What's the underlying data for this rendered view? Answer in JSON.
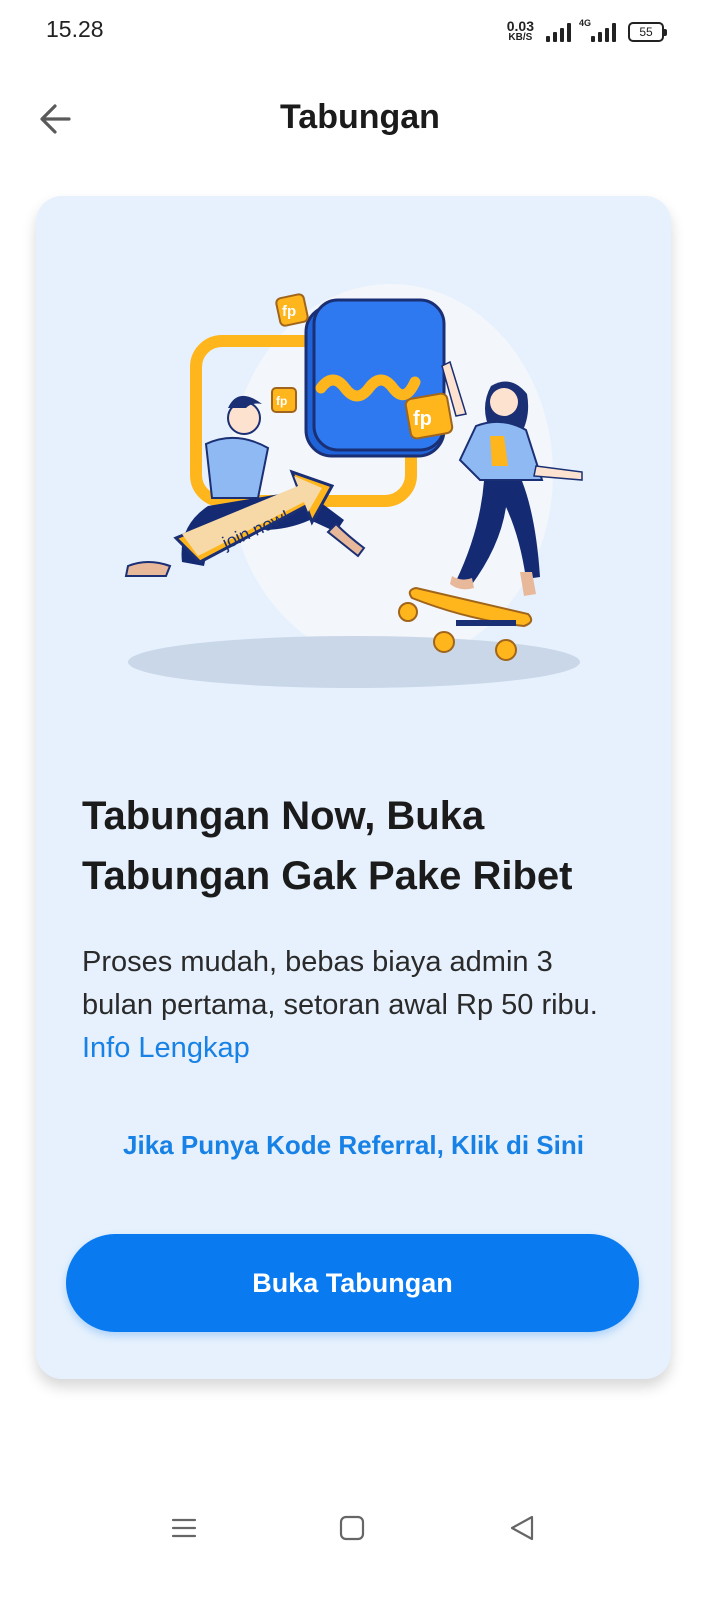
{
  "status_bar": {
    "time": "15.28",
    "net_speed_value": "0.03",
    "net_speed_unit": "KB/S",
    "network_type": "4G",
    "battery": "55"
  },
  "header": {
    "title": "Tabungan",
    "back_icon": "arrow-left-icon"
  },
  "card": {
    "illustration": {
      "badge_text": "fp",
      "arrow_text": "join now!"
    },
    "headline": "Tabungan Now, Buka Tabungan Gak Pake Ribet",
    "description": "Proses mudah, bebas biaya admin 3 bulan pertama, setoran awal Rp 50 ribu.",
    "info_link": "Info Lengkap",
    "referral_link": "Jika Punya Kode Referral, Klik di Sini",
    "primary_button": "Buka Tabungan"
  },
  "nav_bar": {
    "menu_icon": "menu-icon",
    "home_icon": "square-home-icon",
    "back_icon": "triangle-back-icon"
  },
  "colors": {
    "accent": "#0a7af0",
    "link": "#1781e6",
    "card_bg": "#e6f1fd",
    "illustration_yellow": "#ffb51c"
  }
}
